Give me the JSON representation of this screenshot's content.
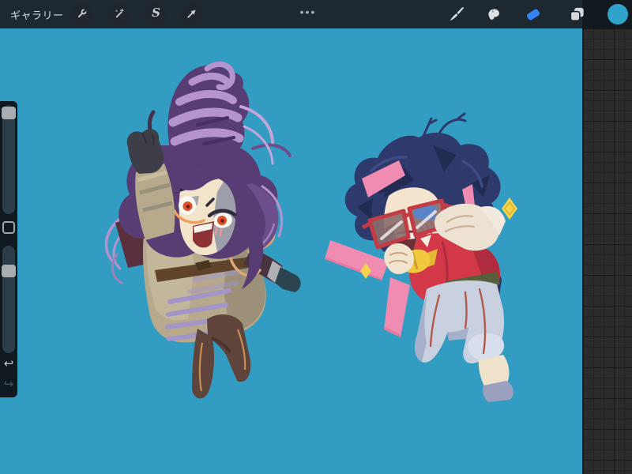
{
  "topbar": {
    "gallery_label": "ギャラリー",
    "menu_dots": "•••",
    "left_tools": [
      {
        "id": "actions",
        "icon": "wrench-icon"
      },
      {
        "id": "adjustments",
        "icon": "magic-wand-icon"
      },
      {
        "id": "selection",
        "icon": "selection-s-icon",
        "glyph": "S"
      },
      {
        "id": "transform",
        "icon": "transform-arrow-icon"
      }
    ],
    "right_tools": [
      {
        "id": "paint",
        "icon": "brush-icon",
        "active": false
      },
      {
        "id": "smudge",
        "icon": "smudge-icon",
        "active": false
      },
      {
        "id": "erase",
        "icon": "eraser-icon",
        "active": true
      },
      {
        "id": "layers",
        "icon": "layers-icon",
        "active": false
      },
      {
        "id": "color",
        "icon": "color-swatch",
        "active": false
      }
    ],
    "active_tool": "erase",
    "colors": {
      "bar_background": "#1E2830",
      "active_tool_blue": "#3183F2",
      "color_swatch": "#2FA3CB",
      "icon_gray": "#C9CDD1"
    }
  },
  "sidebar": {
    "sliders": [
      {
        "name": "brush-size",
        "handle_fraction": 0.03
      },
      {
        "name": "opacity",
        "handle_fraction": 0.18
      }
    ],
    "modify_button": true,
    "undo_glyph": "↩",
    "redo_glyph": "↪"
  },
  "canvas": {
    "background_color": "#339CC3",
    "workspace_background": "#2B2B2B",
    "artwork": {
      "description": "two chibi characters drawn facing each other",
      "left_character": {
        "hair": "purple swirl updo",
        "coat": "tan trench coat with belt",
        "eyes": "red-orange",
        "gloves": "dark gray"
      },
      "right_character": {
        "hair": "navy blue with pink streaks",
        "glasses": "red sunglasses",
        "shirt": "red",
        "pants": "light blue-gray",
        "accent": "yellow star bow"
      },
      "sparkle_color": "#F4D44C"
    }
  }
}
